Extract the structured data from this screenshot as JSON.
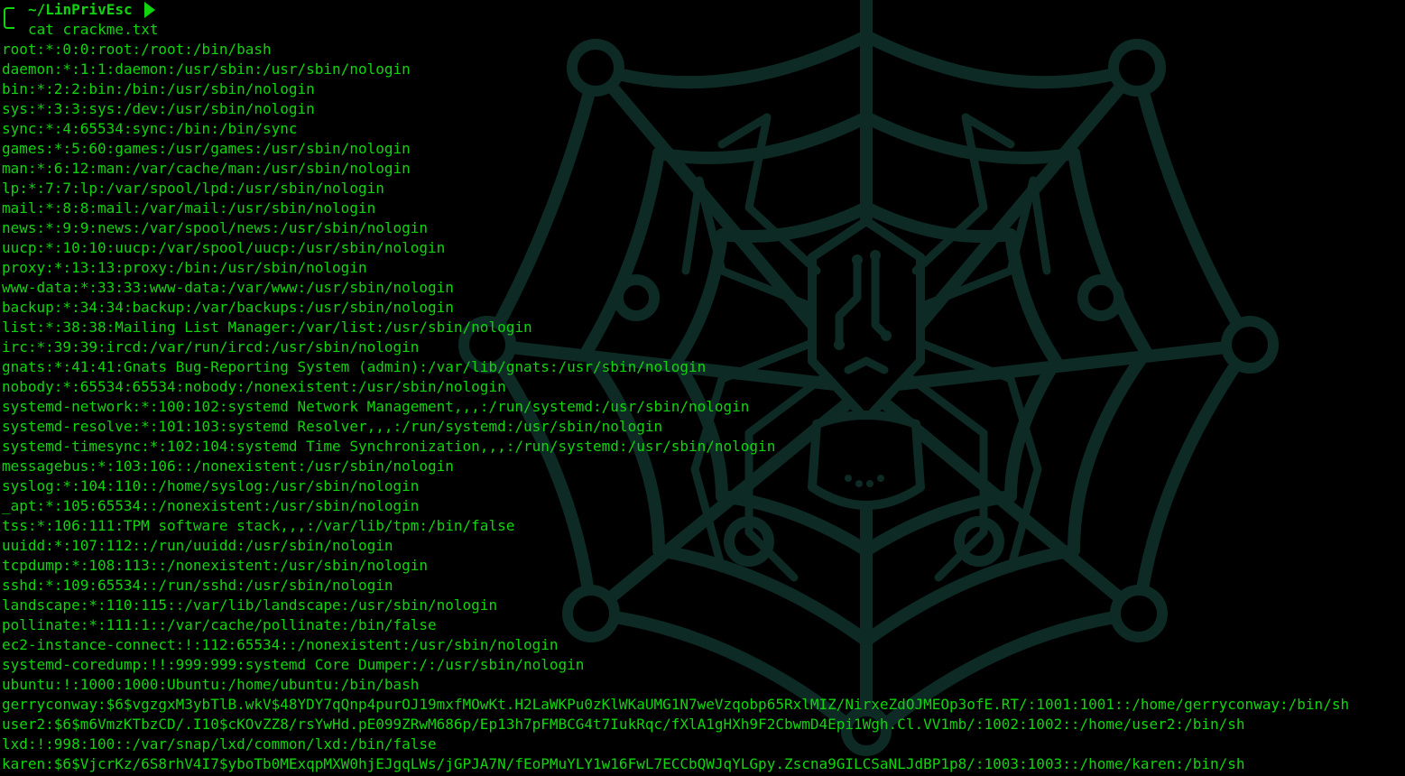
{
  "theme": {
    "background": "#000000",
    "text": "#12d40e",
    "wallpaper": "#0d2a24"
  },
  "wallpaper": {
    "icon": "spider-web-circuit-icon"
  },
  "prompt": {
    "path": "~/LinPrivEsc",
    "command": "cat crackme.txt"
  },
  "output_lines": [
    "root:*:0:0:root:/root:/bin/bash",
    "daemon:*:1:1:daemon:/usr/sbin:/usr/sbin/nologin",
    "bin:*:2:2:bin:/bin:/usr/sbin/nologin",
    "sys:*:3:3:sys:/dev:/usr/sbin/nologin",
    "sync:*:4:65534:sync:/bin:/bin/sync",
    "games:*:5:60:games:/usr/games:/usr/sbin/nologin",
    "man:*:6:12:man:/var/cache/man:/usr/sbin/nologin",
    "lp:*:7:7:lp:/var/spool/lpd:/usr/sbin/nologin",
    "mail:*:8:8:mail:/var/mail:/usr/sbin/nologin",
    "news:*:9:9:news:/var/spool/news:/usr/sbin/nologin",
    "uucp:*:10:10:uucp:/var/spool/uucp:/usr/sbin/nologin",
    "proxy:*:13:13:proxy:/bin:/usr/sbin/nologin",
    "www-data:*:33:33:www-data:/var/www:/usr/sbin/nologin",
    "backup:*:34:34:backup:/var/backups:/usr/sbin/nologin",
    "list:*:38:38:Mailing List Manager:/var/list:/usr/sbin/nologin",
    "irc:*:39:39:ircd:/var/run/ircd:/usr/sbin/nologin",
    "gnats:*:41:41:Gnats Bug-Reporting System (admin):/var/lib/gnats:/usr/sbin/nologin",
    "nobody:*:65534:65534:nobody:/nonexistent:/usr/sbin/nologin",
    "systemd-network:*:100:102:systemd Network Management,,,:/run/systemd:/usr/sbin/nologin",
    "systemd-resolve:*:101:103:systemd Resolver,,,:/run/systemd:/usr/sbin/nologin",
    "systemd-timesync:*:102:104:systemd Time Synchronization,,,:/run/systemd:/usr/sbin/nologin",
    "messagebus:*:103:106::/nonexistent:/usr/sbin/nologin",
    "syslog:*:104:110::/home/syslog:/usr/sbin/nologin",
    "_apt:*:105:65534::/nonexistent:/usr/sbin/nologin",
    "tss:*:106:111:TPM software stack,,,:/var/lib/tpm:/bin/false",
    "uuidd:*:107:112::/run/uuidd:/usr/sbin/nologin",
    "tcpdump:*:108:113::/nonexistent:/usr/sbin/nologin",
    "sshd:*:109:65534::/run/sshd:/usr/sbin/nologin",
    "landscape:*:110:115::/var/lib/landscape:/usr/sbin/nologin",
    "pollinate:*:111:1::/var/cache/pollinate:/bin/false",
    "ec2-instance-connect:!:112:65534::/nonexistent:/usr/sbin/nologin",
    "systemd-coredump:!!:999:999:systemd Core Dumper:/:/usr/sbin/nologin",
    "ubuntu:!:1000:1000:Ubuntu:/home/ubuntu:/bin/bash",
    "gerryconway:$6$vgzgxM3ybTlB.wkV$48YDY7qQnp4purOJ19mxfMOwKt.H2LaWKPu0zKlWKaUMG1N7weVzqobp65RxlMIZ/NirxeZdOJMEOp3ofE.RT/:1001:1001::/home/gerryconway:/bin/sh",
    "user2:$6$m6VmzKTbzCD/.I10$cKOvZZ8/rsYwHd.pE099ZRwM686p/Ep13h7pFMBCG4t7IukRqc/fXlA1gHXh9F2CbwmD4Epi1Wgh.Cl.VV1mb/:1002:1002::/home/user2:/bin/sh",
    "lxd:!:998:100::/var/snap/lxd/common/lxd:/bin/false",
    "karen:$6$VjcrKz/6S8rhV4I7$yboTb0MExqpMXW0hjEJgqLWs/jGPJA7N/fEoPMuYLY1w16FwL7ECCbQWJqYLGpy.Zscna9GILCSaNLJdBP1p8/:1003:1003::/home/karen:/bin/sh"
  ]
}
